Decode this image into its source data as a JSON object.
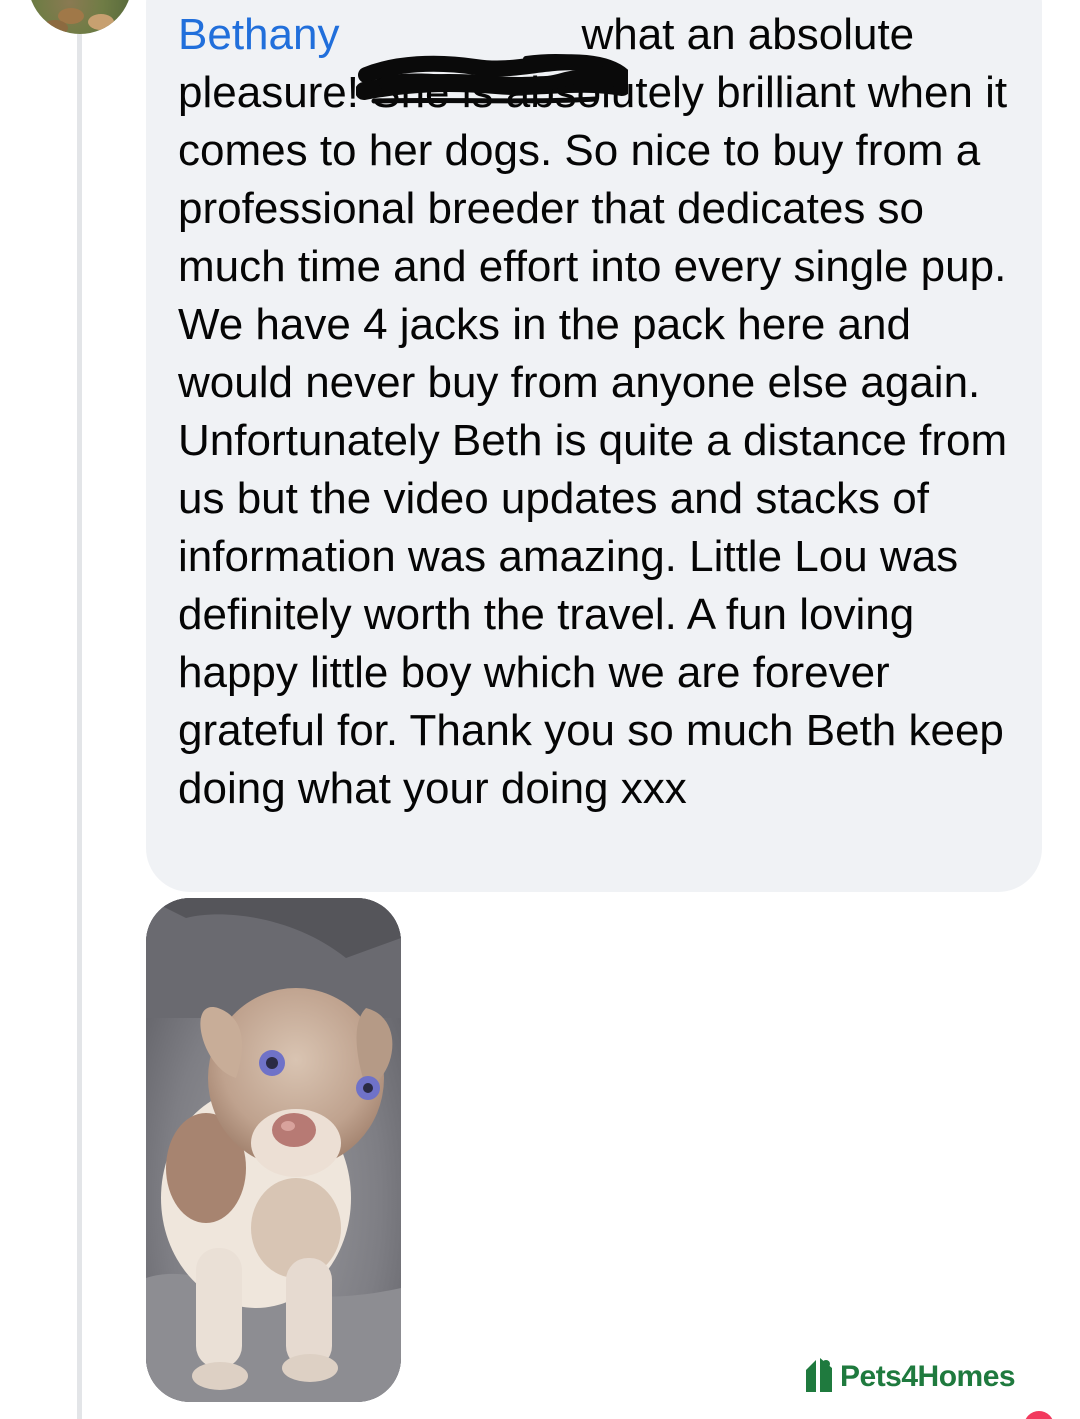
{
  "comment": {
    "author_name": "Bethany",
    "text_after_redaction": "what an absolute pleasure! She is absolutely brilliant when it comes to her dogs. So nice to buy from a professional breeder that dedicates so much time and effort into every single pup. We have 4 jacks in the pack here and would never buy from anyone else again. Unfortunately Beth is quite a distance from us but the video updates and stacks of information was amazing. Little Lou was definitely worth the travel. A fun loving happy little boy which we are forever grateful for. Thank you so much Beth keep doing what your doing xxx",
    "photo_subject": "puppy",
    "redaction": "scribble"
  },
  "watermark": {
    "text": "Pets4Homes",
    "color": "#1f7a3e"
  },
  "colors": {
    "link": "#216fdb",
    "bubble_bg": "#f0f2f5",
    "text": "#050505"
  }
}
